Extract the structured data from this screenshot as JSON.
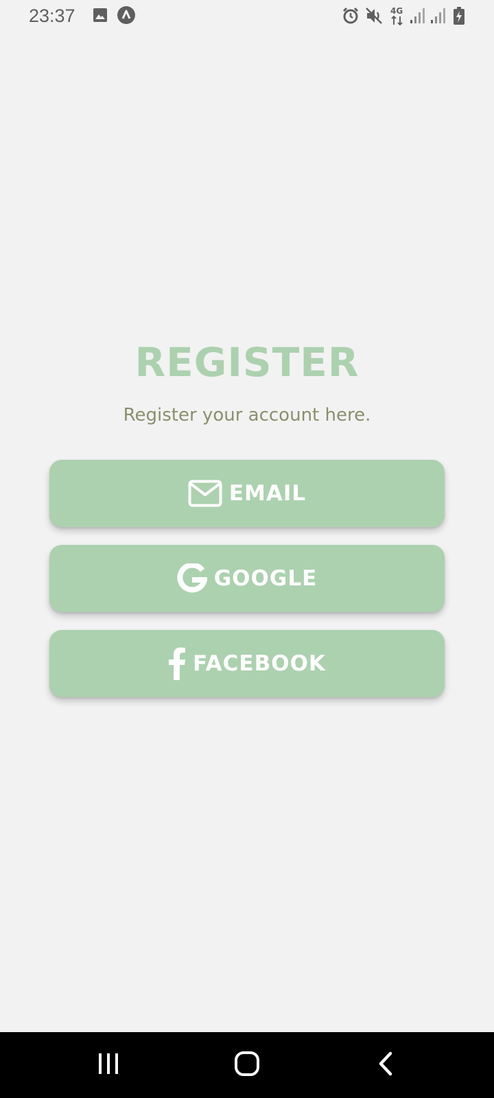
{
  "status_bar": {
    "time": "23:37",
    "left_icons": [
      "image-icon",
      "app-logo-icon"
    ],
    "right_icons": [
      "alarm-icon",
      "mute-icon",
      "4g-data-icon",
      "signal-icon",
      "signal-icon-2",
      "battery-charging-icon"
    ],
    "network_label": "4G"
  },
  "register": {
    "title": "REGISTER",
    "subtitle": "Register your account here."
  },
  "buttons": {
    "email": {
      "label": "EMAIL",
      "icon": "envelope-icon"
    },
    "google": {
      "label": "GOOGLE",
      "icon": "google-icon"
    },
    "facebook": {
      "label": "FACEBOOK",
      "icon": "facebook-icon"
    }
  },
  "nav_bar": {
    "items": [
      "recents-icon",
      "home-icon",
      "back-icon"
    ]
  },
  "colors": {
    "background": "#f2f2f2",
    "accent": "#acd1af",
    "subtitle": "#8a8f6e",
    "status_text": "#5f5f5f",
    "nav_background": "#000000"
  }
}
